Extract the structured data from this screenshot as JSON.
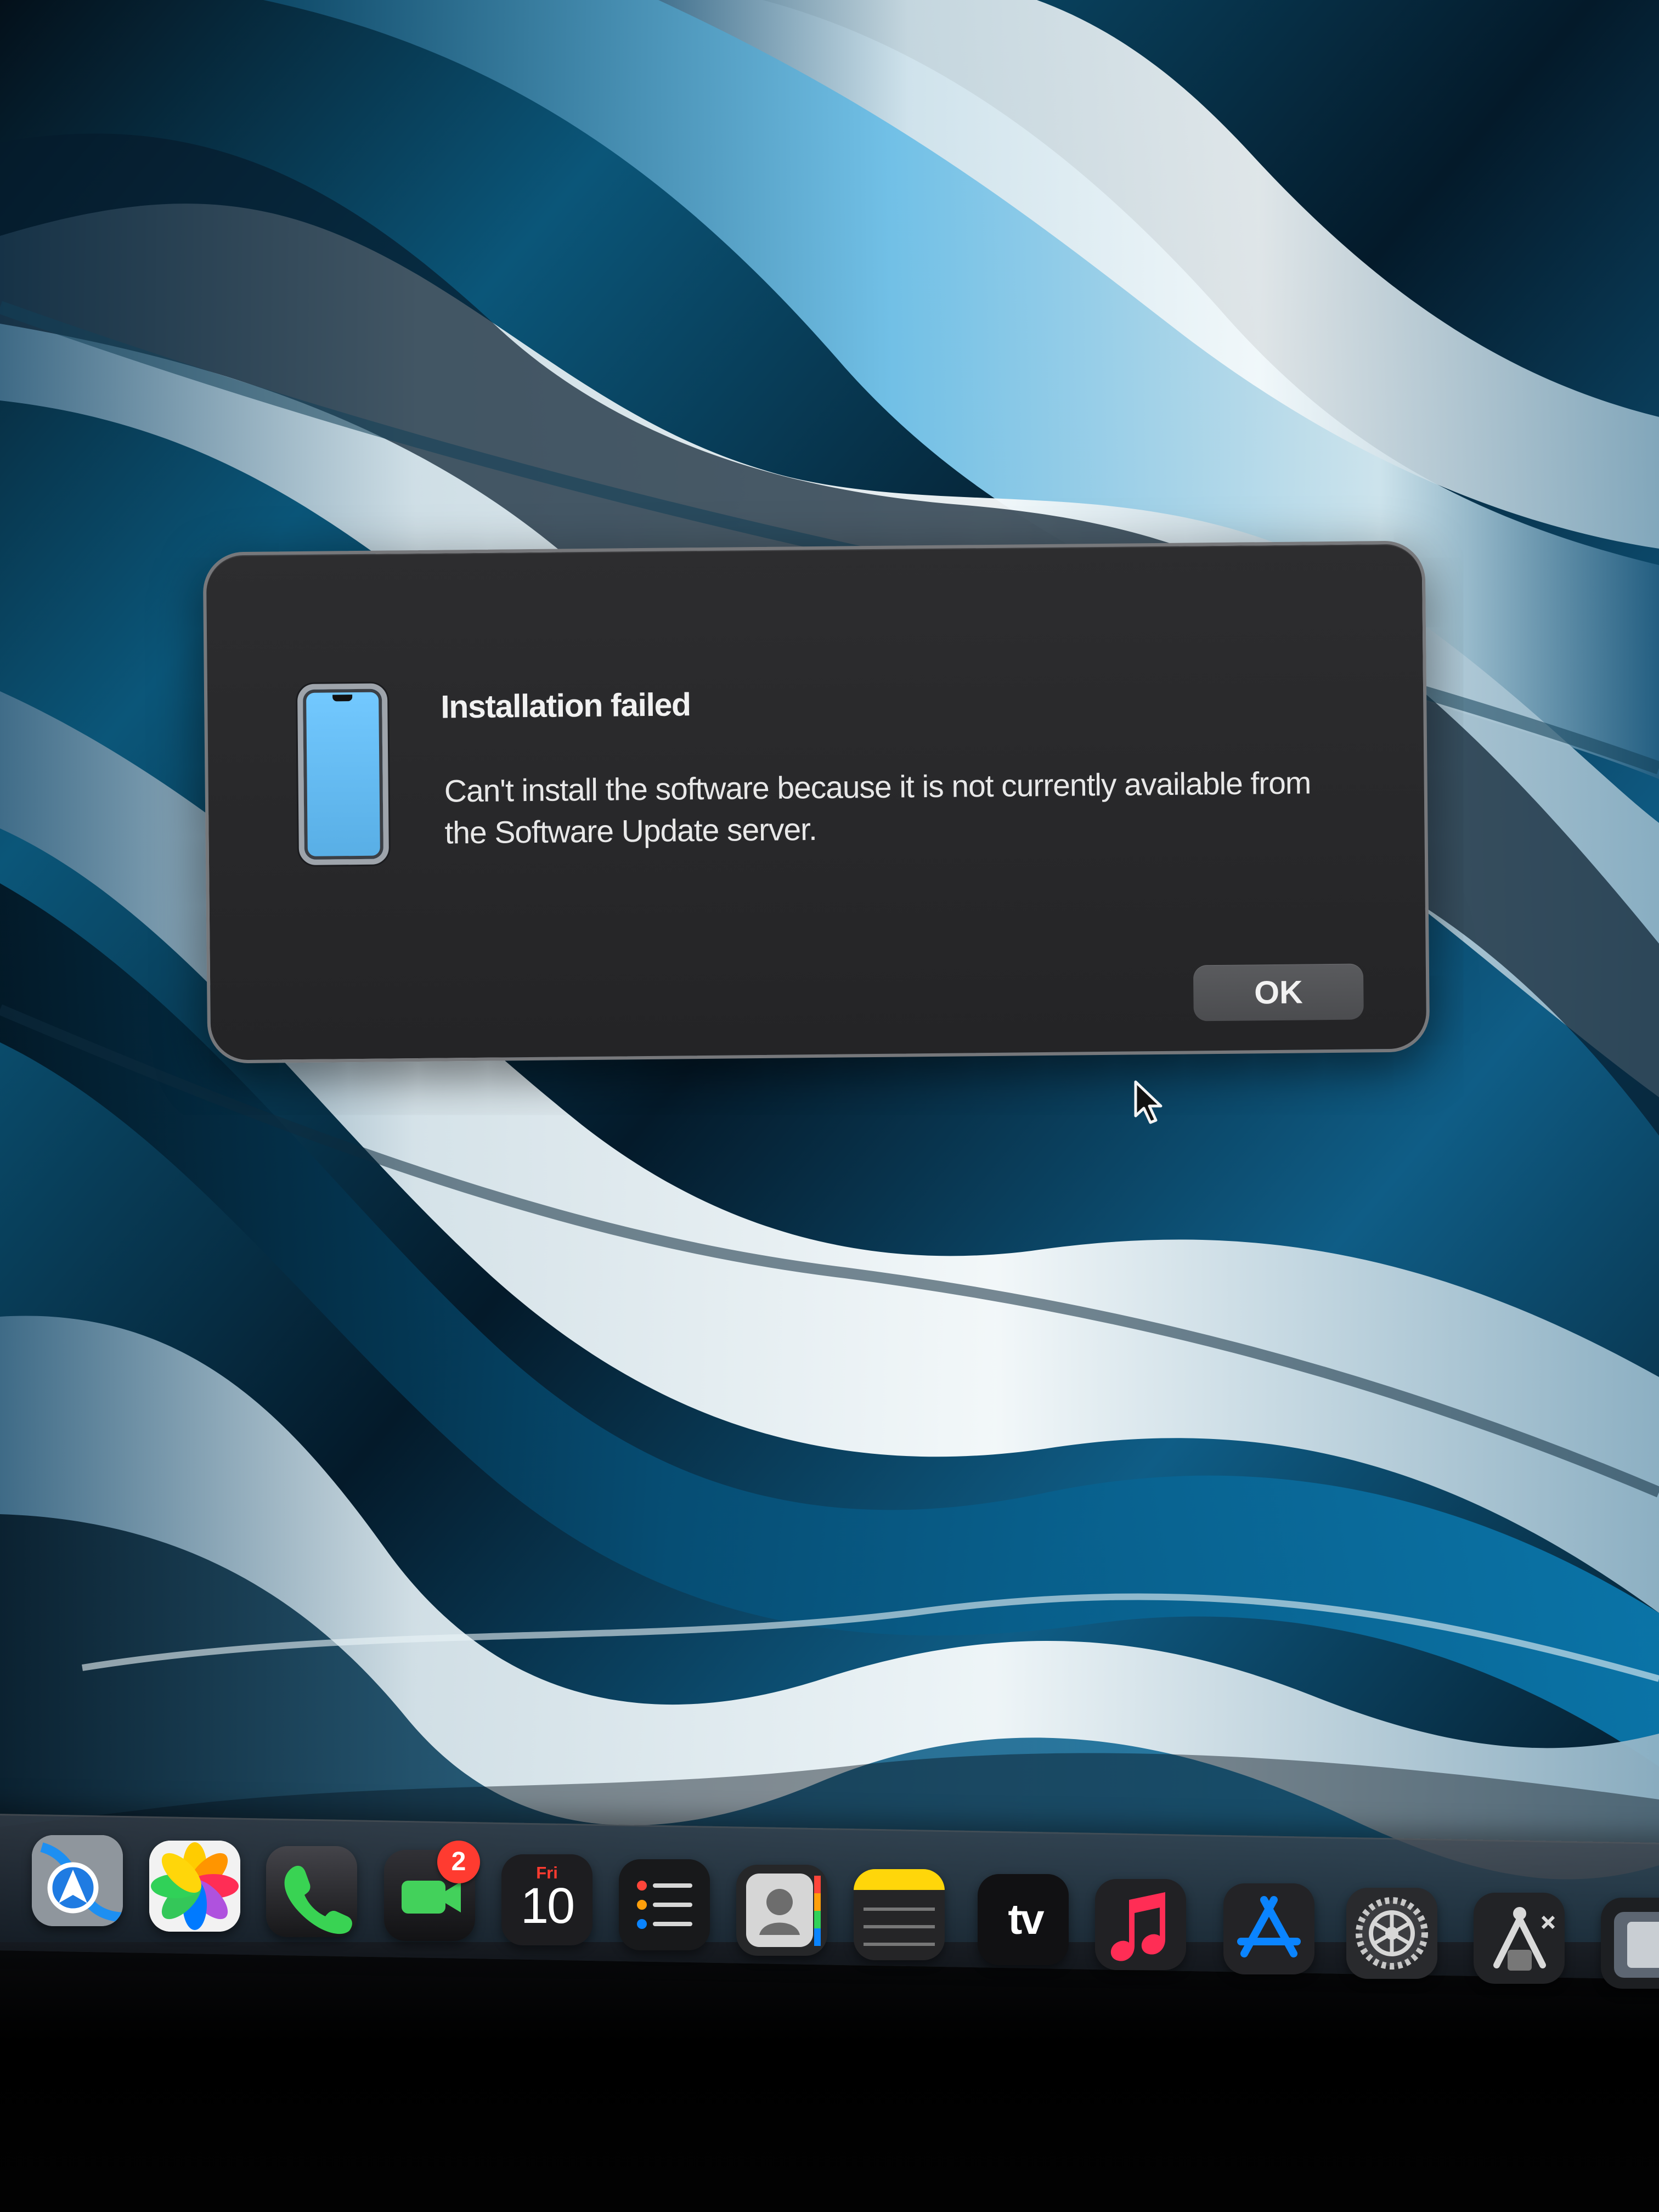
{
  "dialog": {
    "icon": "iphone-device-icon",
    "title": "Installation failed",
    "message": "Can't install the software because it is not currently available from the Software Update server.",
    "ok_label": "OK"
  },
  "dock": {
    "items": [
      {
        "name": "maps",
        "icon": "maps-icon"
      },
      {
        "name": "photos",
        "icon": "photos-icon"
      },
      {
        "name": "phone",
        "icon": "phone-icon"
      },
      {
        "name": "facetime",
        "icon": "facetime-icon",
        "badge": "2"
      },
      {
        "name": "calendar",
        "icon": "calendar-icon",
        "day": "Fri",
        "date": "10"
      },
      {
        "name": "reminders",
        "icon": "reminders-icon"
      },
      {
        "name": "contacts",
        "icon": "contacts-icon"
      },
      {
        "name": "notes",
        "icon": "notes-icon"
      },
      {
        "name": "apple-tv",
        "icon": "apple-tv-icon",
        "label": "tv"
      },
      {
        "name": "music",
        "icon": "music-icon"
      },
      {
        "name": "app-store",
        "icon": "app-store-icon"
      },
      {
        "name": "system-settings",
        "icon": "settings-icon"
      },
      {
        "name": "utility",
        "icon": "utility-icon"
      }
    ]
  },
  "colors": {
    "dialog_background": "#2a2a2c",
    "dialog_border": "#77787b",
    "button_background": "#55565a",
    "wallpaper_blue": "#2f89b8",
    "badge_red": "#ff3b30"
  }
}
